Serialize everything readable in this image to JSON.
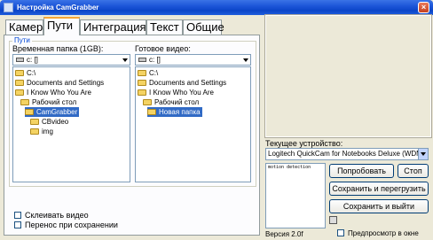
{
  "window": {
    "title": "Настройка CamGrabber",
    "close_glyph": "×"
  },
  "tabs": [
    {
      "label": "Камера",
      "active": false
    },
    {
      "label": "Пути",
      "active": true
    },
    {
      "label": "Интеграция",
      "active": false
    },
    {
      "label": "Текст",
      "active": false
    },
    {
      "label": "Общие",
      "active": false
    }
  ],
  "paths_group": {
    "legend": "Пути",
    "temp": {
      "label": "Временная папка (1GB):",
      "drive": "c: []",
      "tree": [
        {
          "label": "C:\\",
          "level": 0,
          "selected": false
        },
        {
          "label": "Documents and Settings",
          "level": 0,
          "selected": false
        },
        {
          "label": "I Know Who You Are",
          "level": 0,
          "selected": false
        },
        {
          "label": "Рабочий стол",
          "level": 1,
          "selected": false
        },
        {
          "label": "CamGrabber",
          "level": 1,
          "selected": true
        },
        {
          "label": "CBvideo",
          "level": 2,
          "selected": false
        },
        {
          "label": "img",
          "level": 2,
          "selected": false
        }
      ]
    },
    "ready": {
      "label": "Готовое видео:",
      "drive": "c: []",
      "tree": [
        {
          "label": "C:\\",
          "level": 0,
          "selected": false
        },
        {
          "label": "Documents and Settings",
          "level": 0,
          "selected": false
        },
        {
          "label": "I Know Who You Are",
          "level": 0,
          "selected": false
        },
        {
          "label": "Рабочий стол",
          "level": 1,
          "selected": false
        },
        {
          "label": "Новая папка",
          "level": 2,
          "selected": true
        }
      ]
    }
  },
  "checkboxes": {
    "glue_video": "Склеивать видео",
    "transfer_on_save": "Перенос при сохранении"
  },
  "device": {
    "label": "Текущее устройство:",
    "selected": "Logitech QuickCam for Notebooks Deluxe (WDM)"
  },
  "log_text": "motion detection",
  "buttons": {
    "try": "Попробовать",
    "stop": "Стоп",
    "save_restart": "Сохранить и перегрузить",
    "save_exit": "Сохранить и выйти"
  },
  "version": "Версия 2.0f",
  "preview_in_window": "Предпросмотр в окне",
  "colors": {
    "titlebar": "#0b45c8",
    "active_tab_accent": "#f5a636",
    "selection": "#316ac5"
  }
}
